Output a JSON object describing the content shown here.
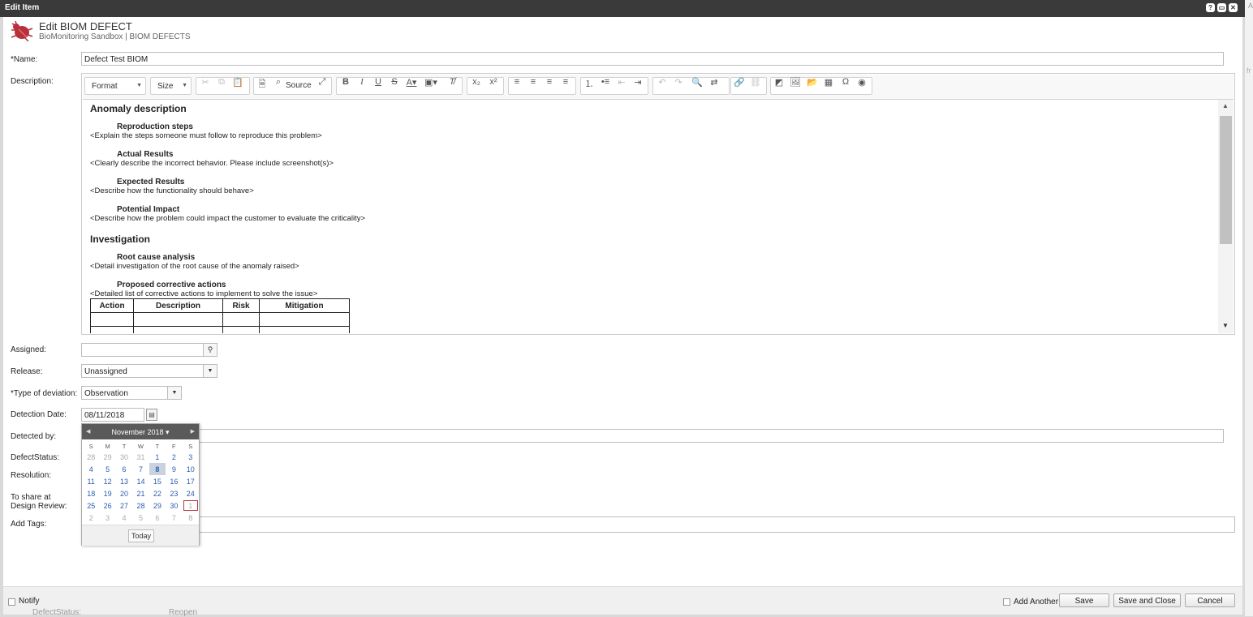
{
  "window": {
    "title": "Edit Item",
    "help_btn": "?",
    "max_btn": "▭",
    "close_btn": "✕"
  },
  "header": {
    "title": "Edit BIOM DEFECT",
    "breadcrumb": "BioMonitoring Sandbox | BIOM DEFECTS",
    "icon": "bug-icon"
  },
  "fields": {
    "name": {
      "label": "*Name:",
      "value": "Defect Test BIOM"
    },
    "description": {
      "label": "Description:"
    },
    "assigned": {
      "label": "Assigned:",
      "value": ""
    },
    "release": {
      "label": "Release:",
      "value": "Unassigned"
    },
    "deviation": {
      "label": "*Type of deviation:",
      "value": "Observation"
    },
    "detection_date": {
      "label": "Detection Date:",
      "value": "08/11/2018"
    },
    "detected_by": {
      "label": "Detected by:"
    },
    "defect_status": {
      "label": "DefectStatus:"
    },
    "resolution": {
      "label": "Resolution:"
    },
    "share_line1": "To share at",
    "share_line2": "Design Review:",
    "tags": {
      "label": "Add Tags:"
    }
  },
  "toolbar": {
    "format": "Format",
    "size": "Size",
    "source": "Source"
  },
  "editor": {
    "h_anomaly": "Anomaly description",
    "s_repro": "Reproduction steps",
    "t_repro": "<Explain the steps someone must follow to reproduce this problem>",
    "s_actual": "Actual Results",
    "t_actual": "<Clearly describe the incorrect behavior. Please include screenshot(s)>",
    "s_expected": "Expected Results",
    "t_expected": "<Describe how the functionality should behave>",
    "s_impact": "Potential Impact",
    "t_impact": "<Describe how the problem could impact the customer to evaluate the criticality>",
    "h_invest": "Investigation",
    "s_root": "Root cause analysis",
    "t_root": "<Detail investigation of the root cause of the anomaly raised>",
    "s_corrective": "Proposed corrective actions",
    "t_corrective": "<Detailed list of corrective actions to implement to solve the issue>",
    "table_headers": [
      "Action",
      "Description",
      "Risk",
      "Mitigation"
    ]
  },
  "calendar": {
    "month_label": "November 2018 ▾",
    "weekdays": [
      "S",
      "M",
      "T",
      "W",
      "T",
      "F",
      "S"
    ],
    "weeks": [
      [
        "28",
        "29",
        "30",
        "31",
        "1",
        "2",
        "3"
      ],
      [
        "4",
        "5",
        "6",
        "7",
        "8",
        "9",
        "10"
      ],
      [
        "11",
        "12",
        "13",
        "14",
        "15",
        "16",
        "17"
      ],
      [
        "18",
        "19",
        "20",
        "21",
        "22",
        "23",
        "24"
      ],
      [
        "25",
        "26",
        "27",
        "28",
        "29",
        "30",
        "1"
      ],
      [
        "2",
        "3",
        "4",
        "5",
        "6",
        "7",
        "8"
      ]
    ],
    "today_label": "Today"
  },
  "footer": {
    "notify_label": "Notify",
    "add_another_label": "Add Another",
    "save": "Save",
    "save_close": "Save and Close",
    "cancel": "Cancel"
  },
  "background": {
    "a": "A",
    "fr": "fr",
    "status_label": "DefectStatus:",
    "status_value": "Reopen"
  },
  "colors": {
    "titlebar": "#3a3a3a",
    "selected_day": "#c9d3e0",
    "today_outline": "#b3363d",
    "link_blue": "#2a5db0"
  }
}
